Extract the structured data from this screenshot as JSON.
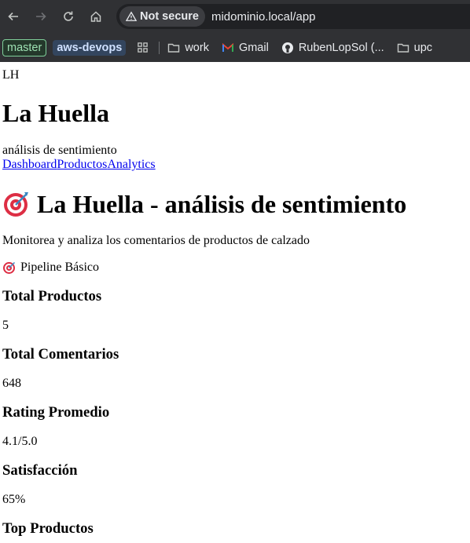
{
  "browser": {
    "security_label": "Not secure",
    "url": "midominio.local/app"
  },
  "bookmarks": {
    "master": "master",
    "aws": "aws-devops",
    "work": "work",
    "gmail": "Gmail",
    "github": "RubenLopSol (...",
    "upc": "upc"
  },
  "header": {
    "logo_text": "LH",
    "brand_title": "La Huella",
    "brand_subtitle": "análisis de sentimiento",
    "nav": [
      "Dashboard",
      "Productos",
      "Analytics"
    ]
  },
  "main": {
    "title": "La Huella - análisis de sentimiento",
    "description": "Monitorea y analiza los comentarios de productos de calzado",
    "pipeline_label": "Pipeline Básico",
    "stats": [
      {
        "title": "Total Productos",
        "value": "5"
      },
      {
        "title": "Total Comentarios",
        "value": "648"
      },
      {
        "title": "Rating Promedio",
        "value": "4.1/5.0"
      },
      {
        "title": "Satisfacción",
        "value": "65%"
      }
    ],
    "next_section_title": "Top Productos"
  }
}
